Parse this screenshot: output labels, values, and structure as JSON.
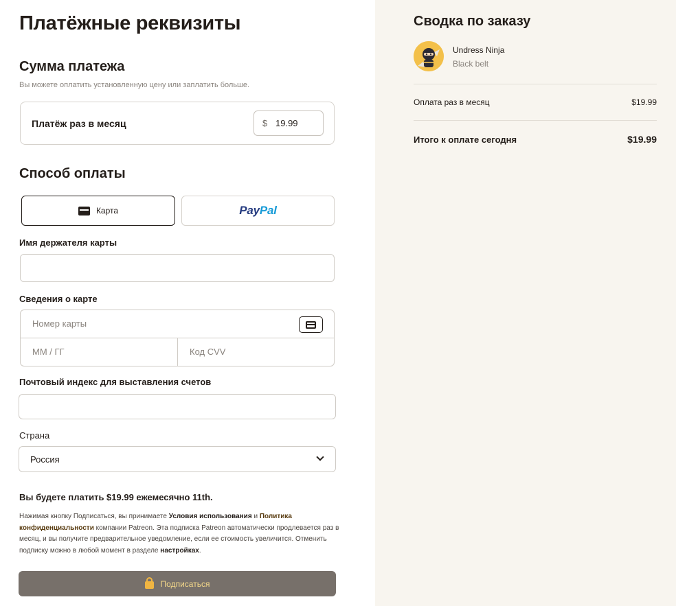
{
  "payment": {
    "page_title": "Платёжные реквизиты",
    "amount_section_title": "Сумма платежа",
    "amount_hint": "Вы можете оплатить установленную цену или заплатить больше.",
    "amount_label": "Платёж раз в месяц",
    "currency_symbol": "$",
    "amount_value": "19.99",
    "method_section_title": "Способ оплаты",
    "method_card_label": "Карта",
    "method_paypal_part1": "Pay",
    "method_paypal_part2": "Pal",
    "cardholder_label": "Имя держателя карты",
    "cardholder_value": "",
    "card_details_label": "Сведения о карте",
    "card_number_placeholder": "Номер карты",
    "card_expiry_placeholder": "ММ / ГГ",
    "card_cvv_placeholder": "Код CVV",
    "postal_label": "Почтовый индекс для выставления счетов",
    "postal_value": "",
    "country_label": "Страна",
    "country_value": "Россия",
    "pay_notice": "Вы будете платить $19.99 ежемесячно 11th.",
    "legal": {
      "p1": "Нажимая кнопку Подписаться, вы принимаете ",
      "terms_link": "Условия использования",
      "p2": " и ",
      "privacy_link": "Политика конфиденциальности",
      "p3": " компании Patreon. Эта подписка Patreon автоматически продлевается раз в месяц, и вы получите предварительное уведомление, если ее стоимость увеличится. Отменить подписку можно в любой момент в разделе ",
      "settings_link": "настройках",
      "p4": "."
    },
    "submit_label": "Подписаться"
  },
  "summary": {
    "title": "Сводка по заказу",
    "product_name": "Undress Ninja",
    "product_tier": "Black belt",
    "monthly_label": "Оплата раз в месяц",
    "monthly_value": "$19.99",
    "total_label": "Итого к оплате сегодня",
    "total_value": "$19.99"
  },
  "colors": {
    "summary_background": "#f8f5ef",
    "submit_background": "#77706a",
    "submit_text": "#f5d98a",
    "lock_icon": "#f0b542",
    "paypal_dark": "#253b80",
    "paypal_light": "#179bd7"
  },
  "icons": {
    "card_method": "credit-card-icon",
    "card_field": "credit-card-outline-icon",
    "country_dropdown": "chevron-down-icon",
    "submit": "lock-icon",
    "avatar": "ninja-avatar-icon"
  }
}
